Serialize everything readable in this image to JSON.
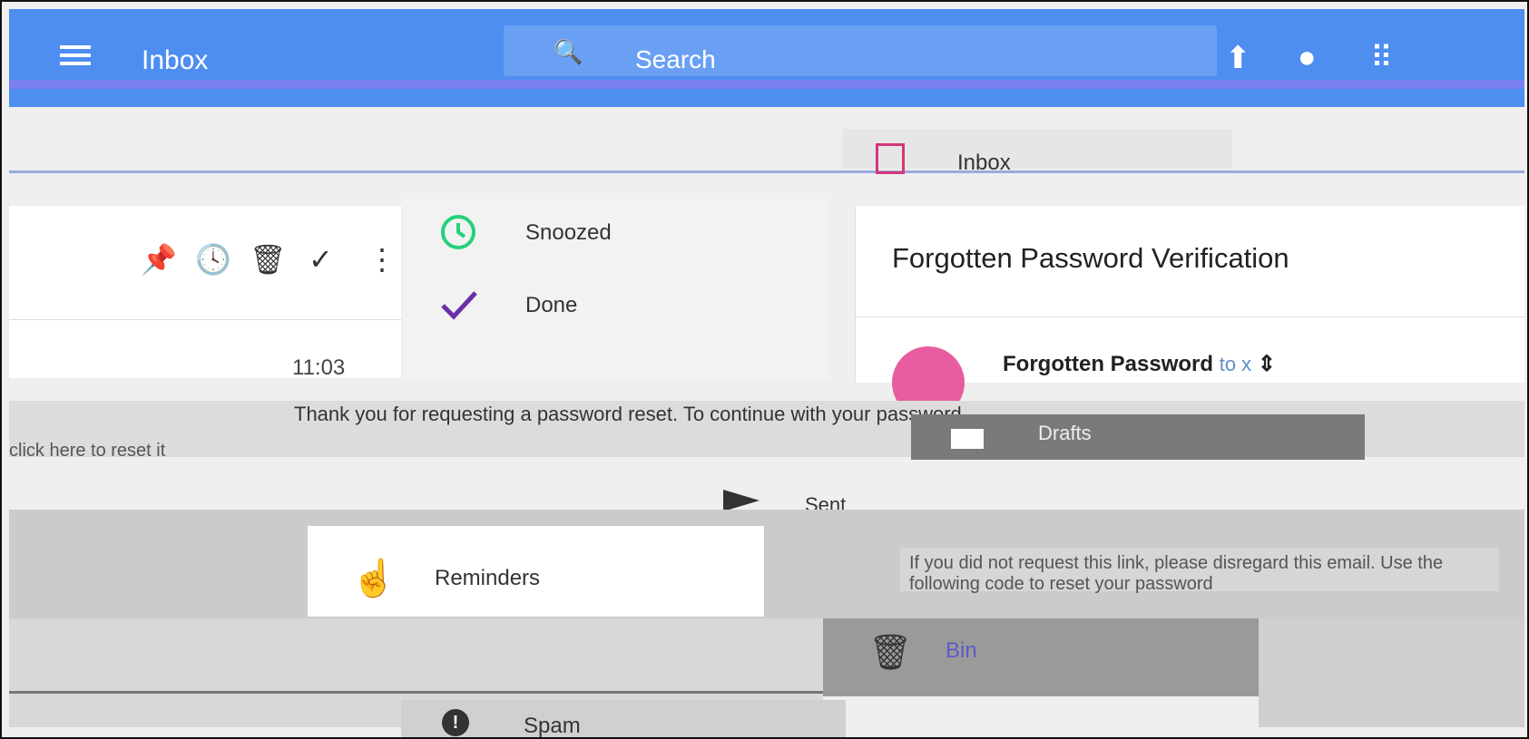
{
  "topbar": {
    "title": "Inbox",
    "search_placeholder": "Search"
  },
  "subbar": {
    "inbox_label": "Inbox"
  },
  "toolbar": {
    "pin": "📌",
    "snooze": "🕓",
    "delete": "🗑",
    "done": "✓",
    "more": "⋮"
  },
  "message_item": {
    "time": "11:03",
    "preview": "Thank you for requesting a password reset. To continue with your password",
    "link_text": "click here to reset it"
  },
  "menu": {
    "snoozed": "Snoozed",
    "done": "Done",
    "sent": "Sent",
    "reminders": "Reminders",
    "bin": "Bin",
    "spam": "Spam",
    "drafts": "Drafts"
  },
  "reading": {
    "subject": "Forgotten Password Verification",
    "sender": "Forgotten Password",
    "to_label": "to x"
  },
  "reading_body": "If you did not request this link, please disregard this email. Use the following code to reset your password"
}
